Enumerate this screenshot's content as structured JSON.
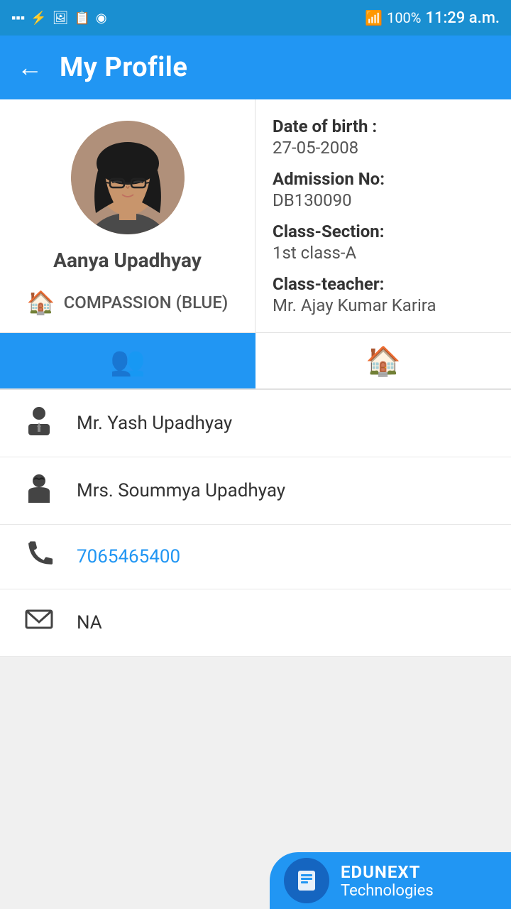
{
  "statusBar": {
    "time": "11:29 a.m.",
    "battery": "100%"
  },
  "header": {
    "title": "My Profile",
    "backLabel": "←"
  },
  "profile": {
    "name": "Aanya Upadhyay",
    "house": "COMPASSION (BLUE)",
    "dob_label": "Date of birth :",
    "dob_value": "27-05-2008",
    "admission_label": "Admission No:",
    "admission_value": "DB130090",
    "class_label": "Class-Section:",
    "class_value": "1st class-A",
    "teacher_label": "Class-teacher:",
    "teacher_value": "Mr. Ajay Kumar Karira"
  },
  "tabs": [
    {
      "id": "family",
      "label": "Family",
      "active": true
    },
    {
      "id": "home",
      "label": "Home",
      "active": false
    }
  ],
  "contacts": [
    {
      "id": "father",
      "icon": "👨‍💼",
      "text": "Mr. Yash  Upadhyay",
      "isLink": false
    },
    {
      "id": "mother",
      "icon": "👩",
      "text": "Mrs. Soummya  Upadhyay",
      "isLink": false
    },
    {
      "id": "phone",
      "icon": "📞",
      "text": "7065465400",
      "isLink": true
    },
    {
      "id": "email",
      "icon": "✉",
      "text": "NA",
      "isLink": false
    }
  ],
  "branding": {
    "name": "EDUNEXT",
    "subtitle": "Technologies",
    "icon": "📖"
  }
}
